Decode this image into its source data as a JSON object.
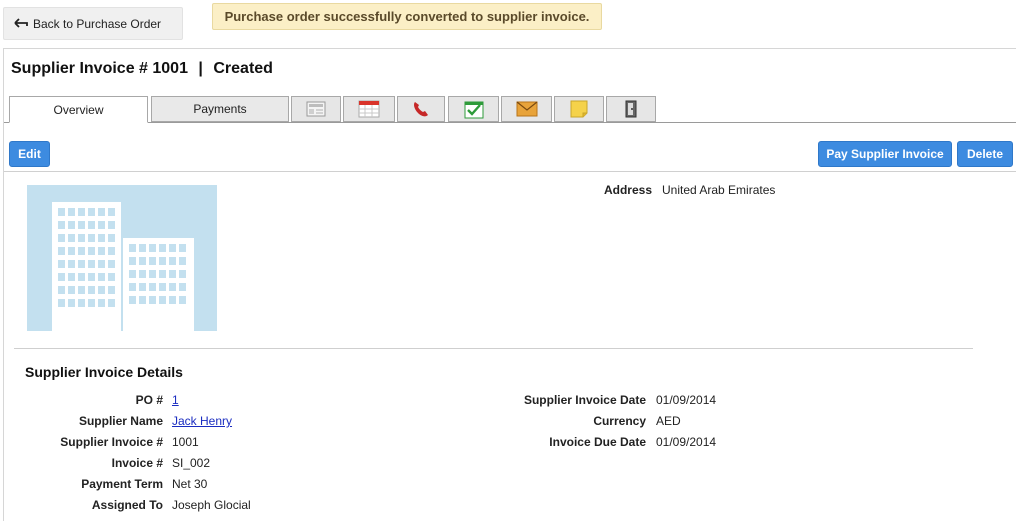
{
  "top": {
    "back_label": "Back to Purchase Order",
    "toast": "Purchase order successfully converted to supplier invoice."
  },
  "header": {
    "title": "Supplier Invoice # 1001",
    "separator": "|",
    "status": "Created"
  },
  "tabs": [
    {
      "label": "Overview",
      "active": true
    },
    {
      "label": "Payments",
      "active": false
    },
    {
      "label": "",
      "icon": "newsletter-icon"
    },
    {
      "label": "",
      "icon": "calendar-icon"
    },
    {
      "label": "",
      "icon": "phone-icon"
    },
    {
      "label": "",
      "icon": "task-check-icon"
    },
    {
      "label": "",
      "icon": "email-envelope-icon"
    },
    {
      "label": "",
      "icon": "note-icon"
    },
    {
      "label": "",
      "icon": "exit-door-icon"
    }
  ],
  "toolbar": {
    "edit_label": "Edit",
    "pay_label": "Pay Supplier Invoice",
    "delete_label": "Delete"
  },
  "address": {
    "label": "Address",
    "value": "United Arab Emirates"
  },
  "details": {
    "title": "Supplier Invoice Details",
    "left": [
      {
        "label": "PO #",
        "value": "1",
        "link": true
      },
      {
        "label": "Supplier Name",
        "value": "Jack Henry",
        "link": true
      },
      {
        "label": "Supplier Invoice #",
        "value": "1001",
        "link": false
      },
      {
        "label": "Invoice #",
        "value": "SI_002",
        "link": false
      },
      {
        "label": "Payment Term",
        "value": "Net 30",
        "link": false
      },
      {
        "label": "Assigned To",
        "value": "Joseph Glocial",
        "link": false
      }
    ],
    "right": [
      {
        "label": "Supplier Invoice Date",
        "value": "01/09/2014"
      },
      {
        "label": "Currency",
        "value": "AED"
      },
      {
        "label": "Invoice Due Date",
        "value": "01/09/2014"
      }
    ]
  },
  "colors": {
    "accent": "#3d8be0",
    "toast_bg": "#fbefc6",
    "image_bg": "#c3e0ef",
    "link": "#1a2cc0"
  }
}
